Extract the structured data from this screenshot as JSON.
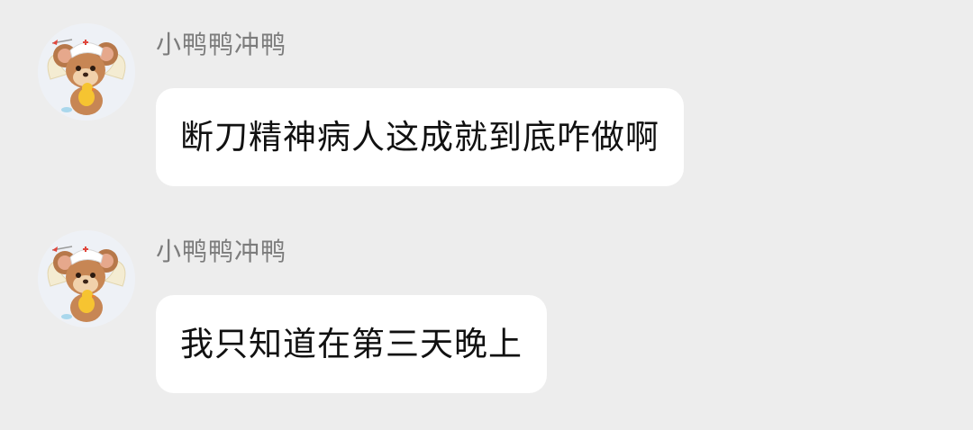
{
  "messages": [
    {
      "sender": "小鸭鸭冲鸭",
      "avatar_icon": "jerry-mouse-angel-avatar",
      "text": "断刀精神病人这成就到底咋做啊"
    },
    {
      "sender": "小鸭鸭冲鸭",
      "avatar_icon": "jerry-mouse-angel-avatar",
      "text": "我只知道在第三天晚上"
    }
  ],
  "colors": {
    "background": "#ededed",
    "bubble": "#ffffff",
    "sender_text": "#7c7c7c",
    "message_text": "#111111"
  }
}
